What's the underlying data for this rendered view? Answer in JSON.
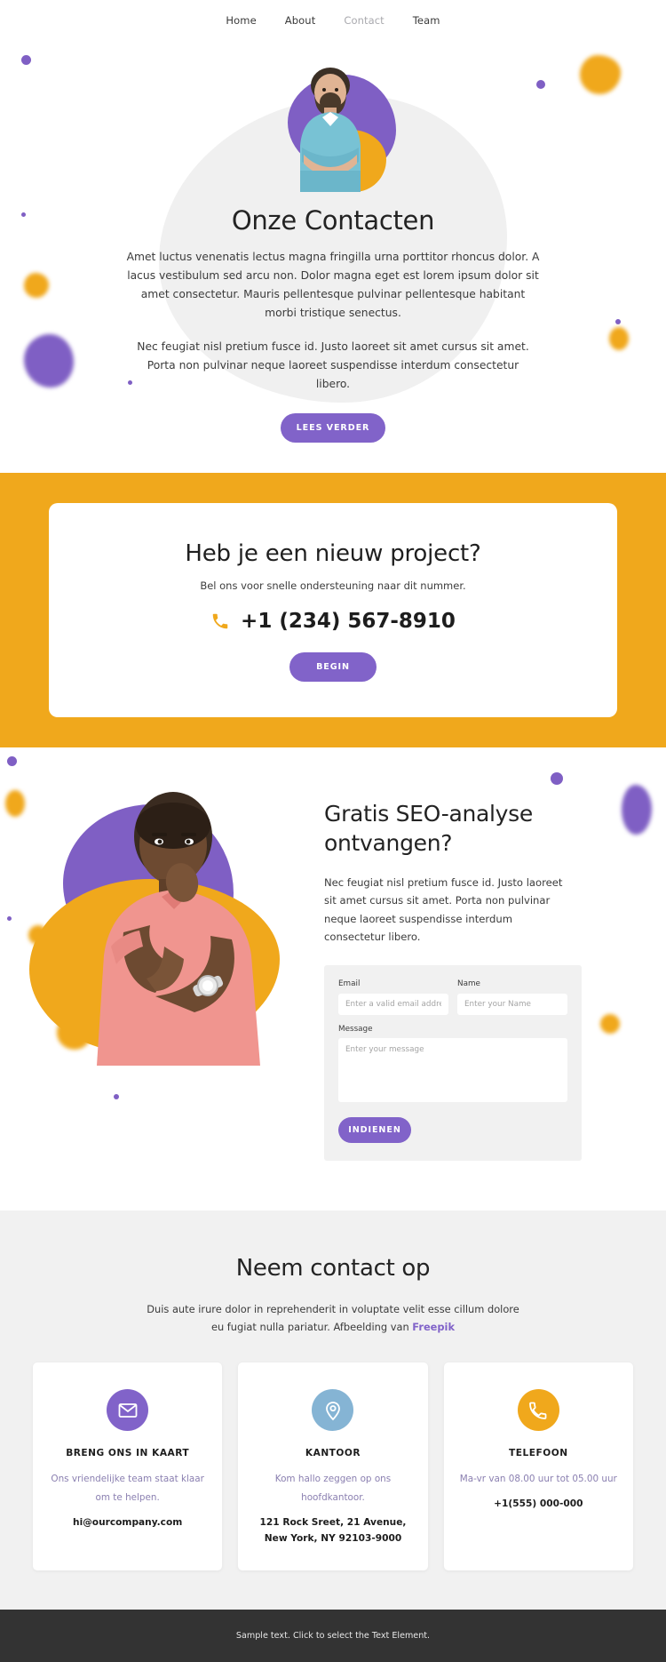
{
  "nav": {
    "items": [
      {
        "label": "Home",
        "active": false
      },
      {
        "label": "About",
        "active": false
      },
      {
        "label": "Contact",
        "active": true
      },
      {
        "label": "Team",
        "active": false
      }
    ]
  },
  "hero": {
    "title": "Onze Contacten",
    "paragraph1": "Amet luctus venenatis lectus magna fringilla urna porttitor rhoncus dolor. A lacus vestibulum sed arcu non. Dolor magna eget est lorem ipsum dolor sit amet consectetur. Mauris pellentesque pulvinar pellentesque habitant morbi tristique senectus.",
    "paragraph2": "Nec feugiat nisl pretium fusce id. Justo laoreet sit amet cursus sit amet. Porta non pulvinar neque laoreet suspendisse interdum consectetur libero.",
    "button_label": "LEES VERDER"
  },
  "cta": {
    "title": "Heb je een nieuw project?",
    "subtitle": "Bel ons voor snelle ondersteuning naar dit nummer.",
    "phone": "+1 (234) 567-8910",
    "phone_icon": "phone-icon",
    "button_label": "BEGIN"
  },
  "seo": {
    "title": "Gratis SEO-analyse ontvangen?",
    "paragraph": "Nec feugiat nisl pretium fusce id. Justo laoreet sit amet cursus sit amet. Porta non pulvinar neque laoreet suspendisse interdum consectetur libero.",
    "form": {
      "email_label": "Email",
      "email_placeholder": "Enter a valid email address",
      "email_value": "",
      "name_label": "Name",
      "name_placeholder": "Enter your Name",
      "name_value": "",
      "message_label": "Message",
      "message_placeholder": "Enter your message",
      "message_value": "",
      "submit_label": "INDIENEN"
    }
  },
  "contact": {
    "title": "Neem contact op",
    "subtitle_before": "Duis aute irure dolor in reprehenderit in voluptate velit esse cillum dolore eu fugiat nulla pariatur. Afbeelding van ",
    "subtitle_link": "Freepik",
    "cards": [
      {
        "icon": "envelope-icon",
        "icon_color": "#8163c9",
        "title": "BRENG ONS IN KAART",
        "desc": "Ons vriendelijke team staat klaar om te helpen.",
        "value": "hi@ourcompany.com"
      },
      {
        "icon": "map-pin-icon",
        "icon_color": "#85b4d4",
        "title": "KANTOOR",
        "desc": "Kom hallo zeggen op ons hoofdkantoor.",
        "value": "121 Rock Sreet, 21 Avenue, New York, NY 92103-9000"
      },
      {
        "icon": "phone-icon",
        "icon_color": "#f0a81c",
        "title": "TELEFOON",
        "desc": "Ma-vr van 08.00 uur tot 05.00 uur",
        "value": "+1(555) 000-000"
      }
    ]
  },
  "footer": {
    "text": "Sample text. Click to select the Text Element."
  },
  "colors": {
    "purple": "#8163c9",
    "orange": "#f0a81c",
    "blue": "#85b4d4",
    "dark": "#333333",
    "light_gray": "#f1f1f1"
  }
}
